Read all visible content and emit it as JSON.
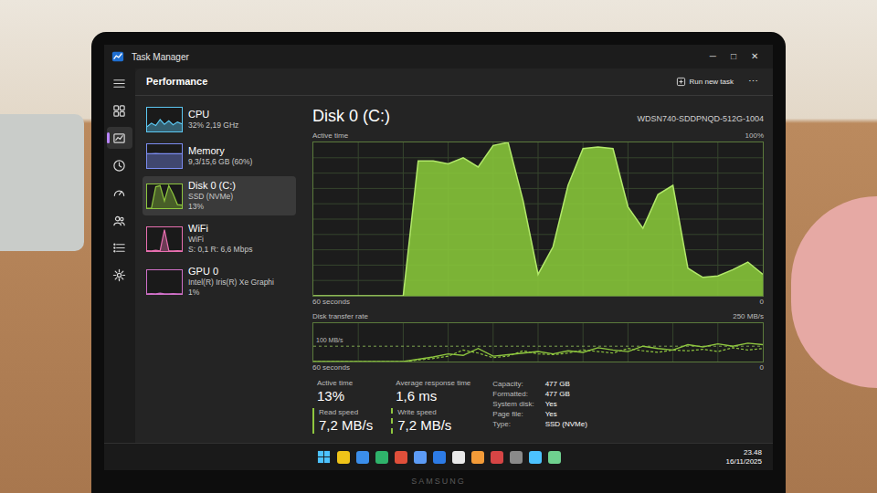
{
  "window": {
    "title": "Task Manager",
    "controls": [
      "─",
      "□",
      "✕"
    ]
  },
  "nav": [
    {
      "kind": "menu",
      "selected": false
    },
    {
      "kind": "processes",
      "selected": false
    },
    {
      "kind": "performance",
      "selected": true
    },
    {
      "kind": "history",
      "selected": false
    },
    {
      "kind": "startup",
      "selected": false
    },
    {
      "kind": "users",
      "selected": false
    },
    {
      "kind": "details",
      "selected": false
    },
    {
      "kind": "services",
      "selected": false
    }
  ],
  "header": {
    "title": "Performance",
    "run_task": "Run new task",
    "more": "⋯"
  },
  "resources": [
    {
      "name": "CPU",
      "details": [
        "32% 2,19 GHz"
      ],
      "color": "#5cc8f2",
      "selected": false,
      "spark": [
        20,
        35,
        25,
        50,
        30,
        45,
        28,
        40,
        32
      ]
    },
    {
      "name": "Memory",
      "details": [
        "9,3/15,6 GB (60%)"
      ],
      "color": "#7b8cf0",
      "selected": false,
      "spark": [
        60,
        60,
        61,
        60,
        60,
        60,
        60,
        60,
        60
      ]
    },
    {
      "name": "Disk 0 (C:)",
      "details": [
        "SSD (NVMe)",
        "13%"
      ],
      "color": "#8ec63f",
      "selected": true,
      "spark": [
        0,
        0,
        90,
        95,
        30,
        95,
        60,
        15,
        13
      ]
    },
    {
      "name": "WiFi",
      "details": [
        "WiFi",
        "S: 0,1 R: 6,6 Mbps"
      ],
      "color": "#e86fb0",
      "selected": false,
      "spark": [
        2,
        1,
        3,
        1,
        90,
        2,
        1,
        2,
        1
      ]
    },
    {
      "name": "GPU 0",
      "details": [
        "Intel(R) Iris(R) Xe Graphi",
        "1%"
      ],
      "color": "#d070c8",
      "selected": false,
      "spark": [
        1,
        2,
        1,
        3,
        1,
        1,
        2,
        1,
        1
      ]
    }
  ],
  "detail": {
    "title": "Disk 0 (C:)",
    "model": "WDSN740-SDDPNQD-512G-1004",
    "active_chart": {
      "label": "Active time",
      "max": "100%",
      "x_label": "60 seconds",
      "min": "0",
      "values": [
        0,
        0,
        0,
        0,
        0,
        0,
        0,
        88,
        88,
        86,
        90,
        84,
        98,
        100,
        62,
        14,
        32,
        72,
        96,
        97,
        96,
        58,
        44,
        66,
        72,
        18,
        12,
        13,
        17,
        22,
        14
      ]
    },
    "transfer_chart": {
      "label": "Disk transfer rate",
      "max": "250 MB/s",
      "ref_label": "100 MB/s",
      "ref_value": 100,
      "scale_max": 250,
      "x_label": "60 seconds",
      "min": "0",
      "read": [
        0,
        0,
        0,
        0,
        0,
        0,
        0,
        15,
        30,
        50,
        40,
        85,
        35,
        45,
        55,
        65,
        50,
        70,
        60,
        90,
        75,
        65,
        100,
        85,
        75,
        110,
        95,
        115,
        100,
        120,
        110
      ],
      "write": [
        0,
        0,
        0,
        0,
        0,
        0,
        0,
        10,
        20,
        35,
        75,
        55,
        25,
        35,
        70,
        50,
        45,
        55,
        75,
        65,
        55,
        85,
        70,
        60,
        75,
        70,
        80,
        65,
        90,
        75,
        85
      ]
    }
  },
  "stats": [
    {
      "label": "Active time",
      "value": "13%",
      "kind": "plain"
    },
    {
      "label": "Average response time",
      "value": "1,6 ms",
      "kind": "plain"
    },
    {
      "label": "Read speed",
      "value": "7,2 MB/s",
      "kind": "read"
    },
    {
      "label": "Write speed",
      "value": "7,2 MB/s",
      "kind": "write"
    }
  ],
  "properties": [
    {
      "key": "Capacity:",
      "value": "477 GB"
    },
    {
      "key": "Formatted:",
      "value": "477 GB"
    },
    {
      "key": "System disk:",
      "value": "Yes"
    },
    {
      "key": "Page file:",
      "value": "Yes"
    },
    {
      "key": "Type:",
      "value": "SSD (NVMe)"
    }
  ],
  "taskbar": {
    "apps": [
      {
        "color": "#f0c419"
      },
      {
        "color": "#3b8eea"
      },
      {
        "color": "#2fb36b"
      },
      {
        "color": "#e04f3a"
      },
      {
        "color": "#5c9bf5"
      },
      {
        "color": "#2d7be5"
      },
      {
        "color": "#e9e9e9"
      },
      {
        "color": "#f29b38"
      },
      {
        "color": "#d64545"
      },
      {
        "color": "#8a8a8a"
      },
      {
        "color": "#4cc2ff"
      },
      {
        "color": "#6fd18f"
      }
    ],
    "time": "23.48",
    "date": "16/11/2025"
  },
  "bezel": {
    "brand": "SAMSUNG"
  }
}
